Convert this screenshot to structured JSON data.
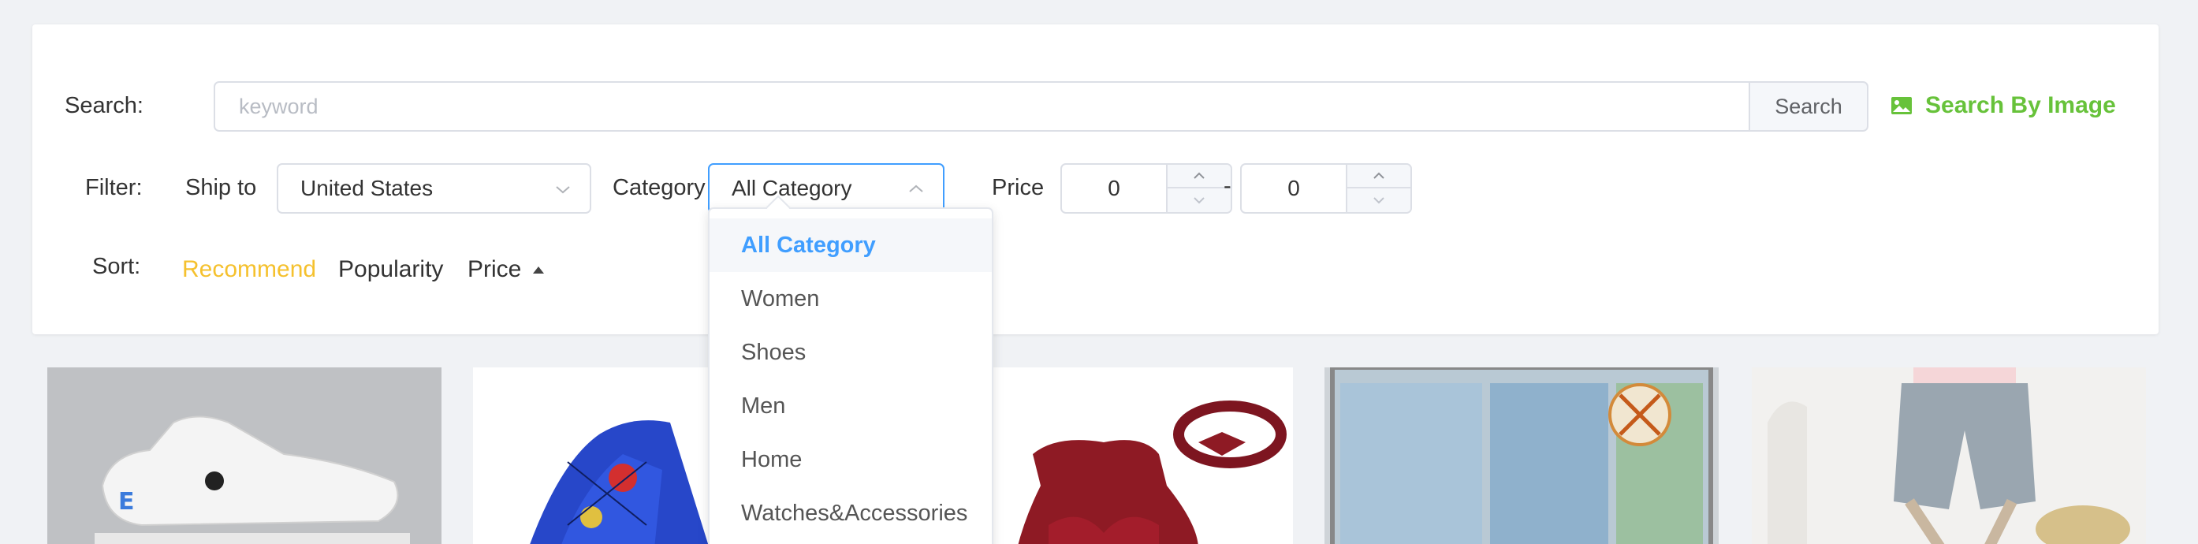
{
  "search": {
    "label": "Search:",
    "placeholder": "keyword",
    "button_label": "Search",
    "by_image_label": "Search By Image"
  },
  "filter": {
    "label": "Filter:",
    "ship_to_label": "Ship to",
    "ship_to_value": "United States",
    "category_label": "Category",
    "category_value": "All Category",
    "price_label": "Price",
    "price_min": "0",
    "price_separator": "-",
    "price_max": "0"
  },
  "sort": {
    "label": "Sort:",
    "options": [
      {
        "label": "Recommend",
        "active": true
      },
      {
        "label": "Popularity",
        "active": false
      },
      {
        "label": "Price",
        "active": false
      }
    ]
  },
  "category_dropdown": {
    "items": [
      {
        "label": "All Category",
        "selected": true
      },
      {
        "label": "Women"
      },
      {
        "label": "Shoes"
      },
      {
        "label": "Men"
      },
      {
        "label": "Home"
      },
      {
        "label": "Watches&Accessories"
      }
    ]
  },
  "colors": {
    "accent_green": "#67c23a",
    "accent_blue": "#409eff",
    "sort_active": "#f5c12e"
  },
  "products": [
    {
      "icon": "clog-shoe-image"
    },
    {
      "icon": "spider-print-hoodie-image"
    },
    {
      "icon": "red-dress-bow-image"
    },
    {
      "icon": "window-screen-image"
    },
    {
      "icon": "denim-shorts-image"
    }
  ]
}
